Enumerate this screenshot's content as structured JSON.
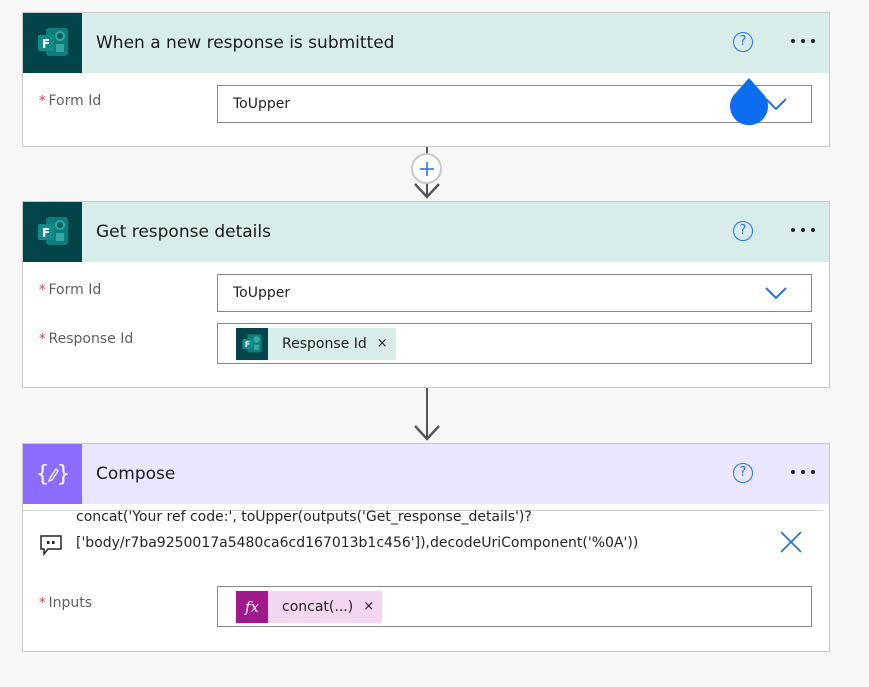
{
  "cards": [
    {
      "title": "When a new response is submitted",
      "icon": "forms-icon",
      "help_label": "?",
      "fields": [
        {
          "label": "Form Id",
          "required": "*",
          "value": "ToUpper",
          "type": "dropdown"
        }
      ]
    },
    {
      "title": "Get response details",
      "icon": "forms-icon",
      "help_label": "?",
      "fields": [
        {
          "label": "Form Id",
          "required": "*",
          "value": "ToUpper",
          "type": "dropdown"
        },
        {
          "label": "Response Id",
          "required": "*",
          "token": "Response Id",
          "token_remove": "×",
          "type": "token"
        }
      ]
    },
    {
      "title": "Compose",
      "icon": "compose-icon",
      "help_label": "?",
      "comment": "concat('Your ref code:', toUpper(outputs('Get_response_details')?['body/r7ba9250017a5480ca6cd167013b1c456']),decodeUriComponent('%0A'))",
      "fields": [
        {
          "label": "Inputs",
          "required": "*",
          "token": "concat(...)",
          "token_icon": "fx",
          "token_remove": "×",
          "type": "token"
        }
      ]
    }
  ],
  "colors": {
    "forms_brand": "#02444a",
    "forms_header": "#d8ecea",
    "compose_brand": "#8c6cff",
    "compose_header": "#ebe6ff",
    "expression_token": "#a01a8c",
    "accent": "#2b6fe6",
    "cursor_drop": "#0b6cf0",
    "required": "#d13438"
  }
}
